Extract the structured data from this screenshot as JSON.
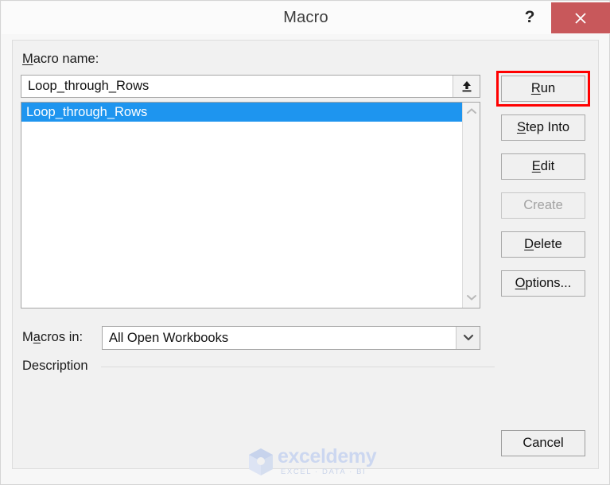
{
  "window": {
    "title": "Macro",
    "help_label": "?",
    "close_icon": "close-icon",
    "close_color": "#c8585b"
  },
  "macro_name": {
    "label": "Macro name:",
    "label_accel": "M",
    "value": "Loop_through_Rows",
    "placeholder": "Macro name",
    "upload_icon": "upload-arrow-icon"
  },
  "macro_list": {
    "items": [
      {
        "label": "Loop_through_Rows",
        "selected": true
      }
    ],
    "selection_color": "#1e95ef",
    "scroll_up_icon": "chevron-up-icon",
    "scroll_down_icon": "chevron-down-icon"
  },
  "macros_in": {
    "label": "Macros in:",
    "label_accel": "a",
    "value": "All Open Workbooks",
    "dropdown_icon": "chevron-down-icon"
  },
  "description": {
    "label": "Description",
    "text": ""
  },
  "buttons": {
    "run": {
      "label": "Run",
      "accel": "R",
      "enabled": true,
      "highlighted": true
    },
    "step_into": {
      "label": "Step Into",
      "accel": "S",
      "enabled": true,
      "highlighted": false
    },
    "edit": {
      "label": "Edit",
      "accel": "E",
      "enabled": true,
      "highlighted": false
    },
    "create": {
      "label": "Create",
      "accel": "",
      "enabled": false,
      "highlighted": false
    },
    "delete": {
      "label": "Delete",
      "accel": "D",
      "enabled": true,
      "highlighted": false
    },
    "options": {
      "label": "Options...",
      "accel": "O",
      "enabled": true,
      "highlighted": false
    },
    "cancel": {
      "label": "Cancel",
      "accel": "",
      "enabled": true,
      "highlighted": false
    }
  },
  "highlight": {
    "color": "#ff0000"
  },
  "watermark": {
    "name": "exceldemy",
    "tagline": "EXCEL · DATA · BI",
    "color": "#ccd7f0"
  }
}
